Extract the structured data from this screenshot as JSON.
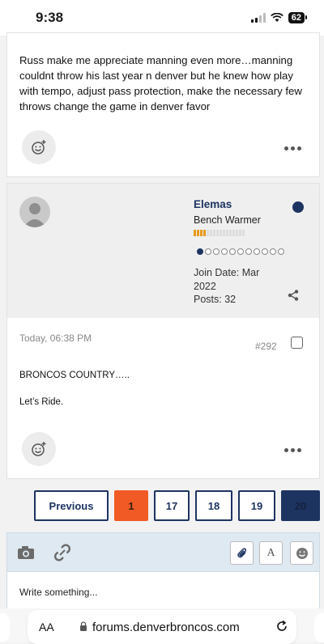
{
  "status": {
    "time": "9:38",
    "battery": "62"
  },
  "post1": {
    "body": "Russ make me appreciate manning even more…manning couldnt throw his last year n denver but he knew how play with tempo, adjust pass protection, make the necessary few throws change the game in denver favor"
  },
  "post2": {
    "author": {
      "username": "Elemas",
      "rank": "Bench Warmer",
      "join_date": "Join Date: Mar 2022",
      "posts": "Posts: 32",
      "online_color": "#1d3461"
    },
    "date": "Today, 06:38 PM",
    "number": "#292",
    "lines": [
      "BRONCOS COUNTRY…..",
      "Let’s Ride."
    ]
  },
  "pagination": {
    "previous": "Previous",
    "pages": [
      "1",
      "17",
      "18",
      "19",
      "20"
    ],
    "active_page": "1"
  },
  "editor": {
    "placeholder": "Write something..."
  },
  "browser": {
    "aa": "AA",
    "url": "forums.denverbroncos.com"
  },
  "colors": {
    "accent": "#f15a24",
    "brand": "#1d3461",
    "rank_bar": "#e69a1e"
  }
}
